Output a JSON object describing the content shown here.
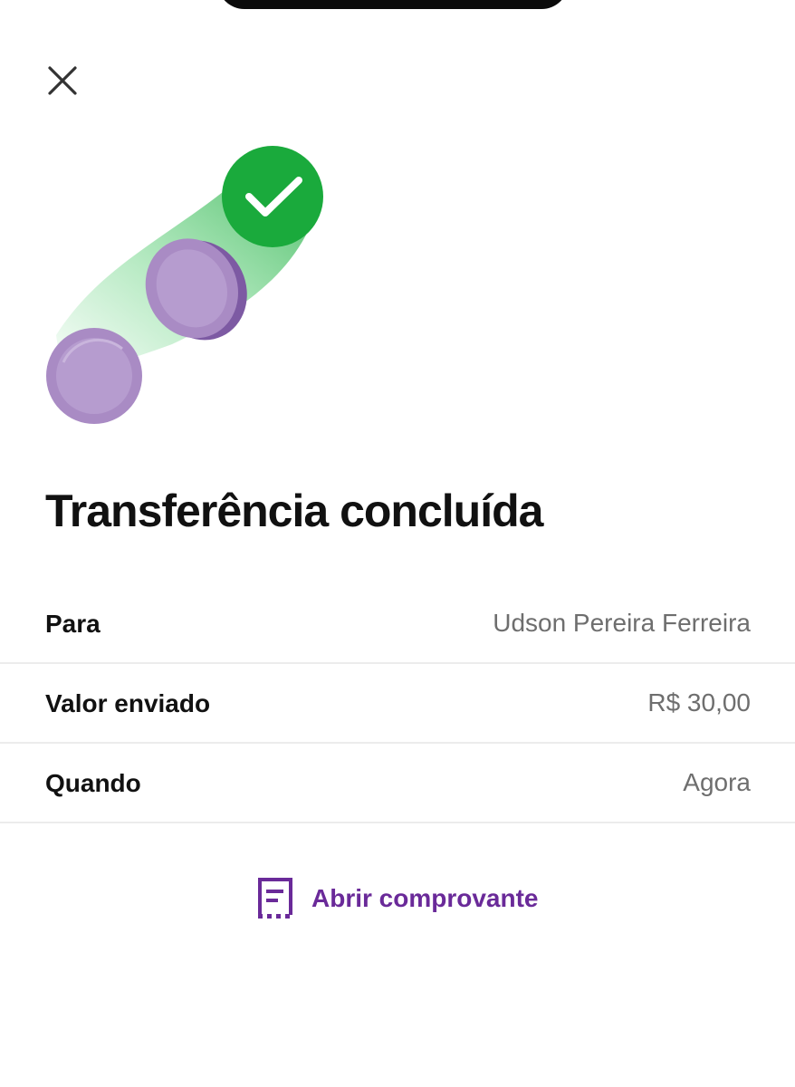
{
  "header": {
    "close_icon": "close-icon"
  },
  "illustration": {
    "success_icon": "check-circle-icon",
    "coin_color": "#a98bc4",
    "check_color": "#1aaa3c"
  },
  "title": "Transferência concluída",
  "details": [
    {
      "label": "Para",
      "value": "Udson Pereira Ferreira"
    },
    {
      "label": "Valor enviado",
      "value": "R$ 30,00"
    },
    {
      "label": "Quando",
      "value": "Agora"
    }
  ],
  "actions": {
    "open_receipt_label": "Abrir comprovante",
    "open_receipt_icon": "receipt-icon",
    "accent_color": "#6a2a99"
  }
}
